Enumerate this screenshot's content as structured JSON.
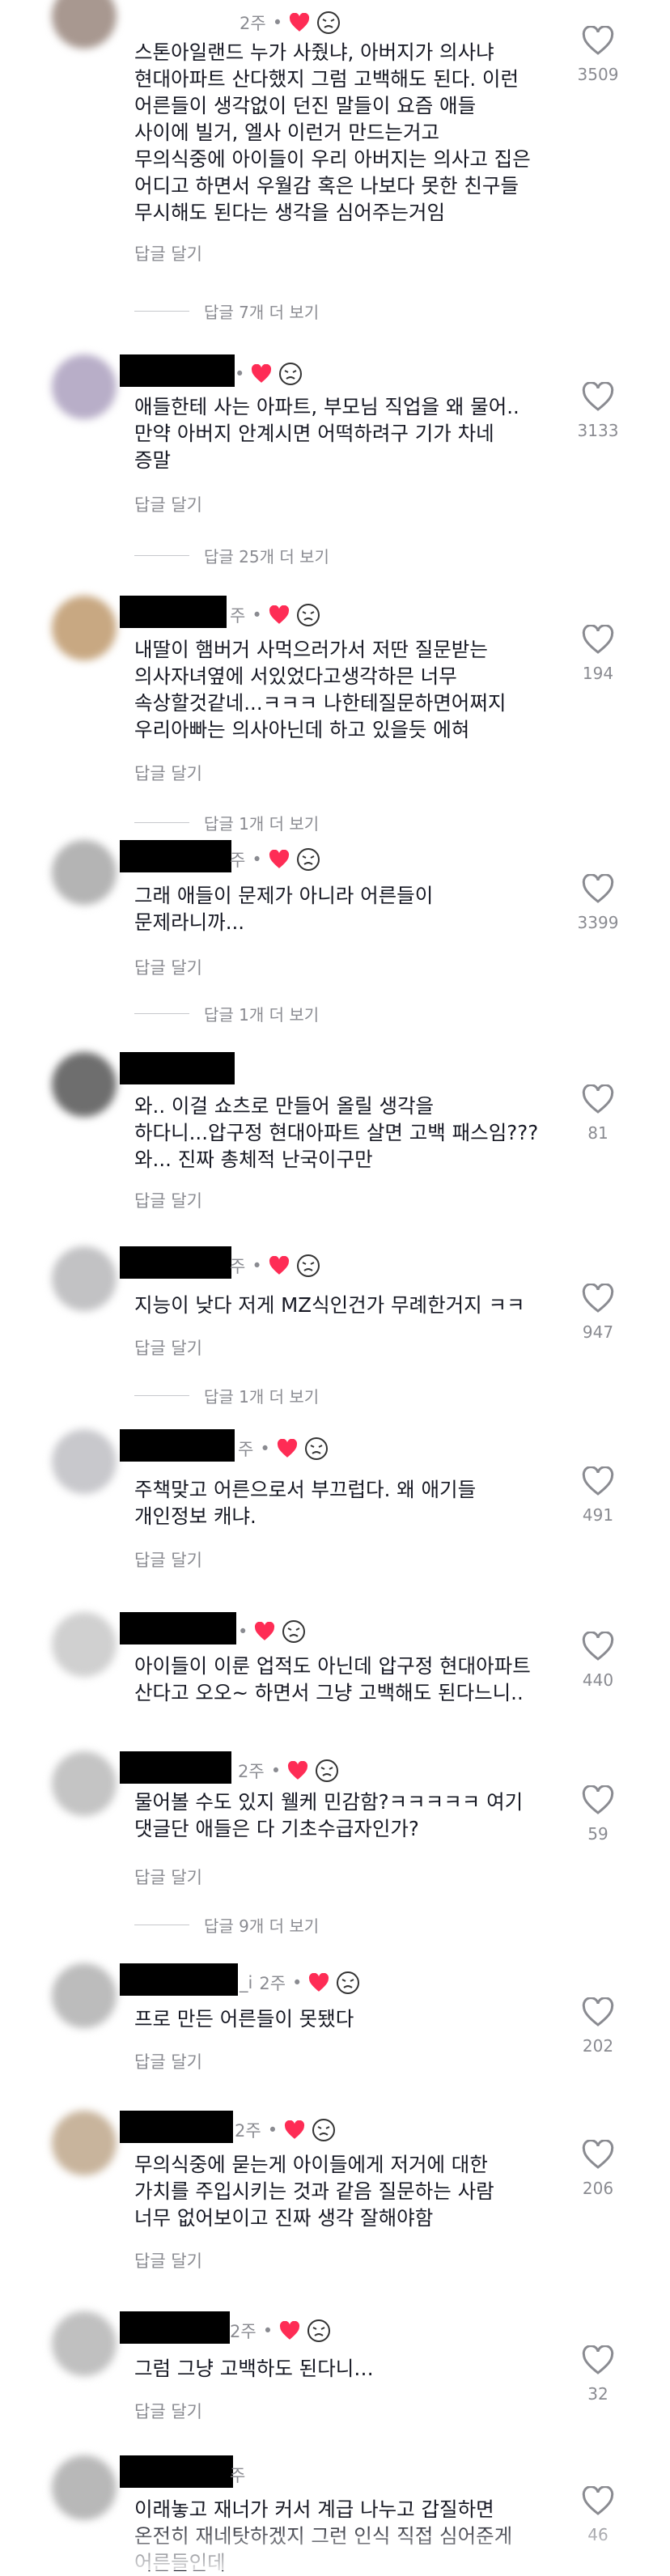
{
  "comments": [
    {
      "time": "2주",
      "text": "스톤아일랜드 누가 사줬냐, 아버지가 의사냐\n현대아파트 산다했지 그럼 고백해도 된다. 이런\n어른들이 생각없이 던진 말들이 요즘 애들\n사이에 빌거, 엘사 이런거 만드는거고\n무의식중에 아이들이 우리 아버지는 의사고 집은\n어디고 하면서 우월감 혹은 나보다 못한 친구들\n무시해도 된다는 생각을 심어주는거임",
      "likes": "3509",
      "reply": "답글 달기",
      "more": "답글 7개 더 보기",
      "avatar": "#a89890"
    },
    {
      "time": "",
      "text": "애들한테 사는 아파트, 부모님 직업을 왜 물어..\n만약 아버지 안계시면 어떡하려구 기가 차네\n증말",
      "likes": "3133",
      "reply": "답글 달기",
      "more": "답글 25개 더 보기",
      "avatar": "#b8aec8"
    },
    {
      "time": "주",
      "text": "내딸이 햄버거 사먹으러가서 저딴 질문받는\n의사자녀옆에 서있었다고생각하믄 너무\n속상할것같네...ㅋㅋㅋ 나한테질문하면어쩌지\n우리아빠는 의사아닌데 하고 있을듯 에혀",
      "likes": "194",
      "reply": "답글 달기",
      "more": "답글 1개 더 보기",
      "avatar": "#c8a882"
    },
    {
      "time": "주",
      "text": "그래 애들이 문제가 아니라 어른들이\n문제라니까...",
      "likes": "3399",
      "reply": "답글 달기",
      "more": "답글 1개 더 보기",
      "avatar": "#b4b4b4"
    },
    {
      "time": "",
      "text": "와.. 이걸 쇼츠로 만들어 올릴 생각을\n하다니...압구정 현대아파트 살면 고백 패스임???\n와... 진짜 총체적 난국이구만",
      "likes": "81",
      "reply": "답글 달기",
      "more": "",
      "avatar": "#6e6e6e"
    },
    {
      "time": "주",
      "text": "지능이 낮다 저게 MZ식인건가 무례한거지 ㅋㅋ",
      "likes": "947",
      "reply": "답글 달기",
      "more": "답글 1개 더 보기",
      "avatar": "#c2c2c4"
    },
    {
      "time": "주",
      "text": "주책맞고 어른으로서 부끄럽다. 왜 애기들\n개인정보 캐냐.",
      "likes": "491",
      "reply": "답글 달기",
      "more": "",
      "avatar": "#c8c8cc"
    },
    {
      "time": "",
      "text": "아이들이 이룬 업적도 아닌데 압구정 현대아파트\n산다고 오오~ 하면서 그냥 고백해도 된다느니..",
      "likes": "440",
      "reply": "",
      "more": "",
      "avatar": "#d0d0d0"
    },
    {
      "time": "2주",
      "text": "물어볼 수도 있지 웰케 민감함?ㅋㅋㅋㅋㅋ 여기\n댓글단 애들은 다 기초수급자인가?",
      "likes": "59",
      "reply": "답글 달기",
      "more": "답글 9개 더 보기",
      "avatar": "#c4c4c4"
    },
    {
      "time": "2주",
      "text": "프로 만든 어른들이 못됐다",
      "likes": "202",
      "reply": "답글 달기",
      "more": "",
      "avatar": "#bcbcbc",
      "name_suffix": "_i"
    },
    {
      "time": "2주",
      "text": "무의식중에 묻는게 아이들에게 저거에 대한\n가치를 주입시키는 것과 같음 질문하는 사람\n너무 없어보이고 진짜 생각 잘해야함",
      "likes": "206",
      "reply": "답글 달기",
      "more": "",
      "avatar": "#c8b49c"
    },
    {
      "time": "2주",
      "text": "그럼 그냥 고백하도 된다니…",
      "likes": "32",
      "reply": "답글 달기",
      "more": "",
      "avatar": "#c0c0c0"
    },
    {
      "time": "주",
      "text": "이래놓고 재너가 커서 계급 나누고 갑질하면\n온전히 재네탓하겠지 그런 인식 직접 심어준게\n어른들인데",
      "likes": "46",
      "reply": "",
      "more": "",
      "avatar": "#b8b8b8"
    }
  ],
  "colors": {
    "heart_red": "#fe2c55",
    "meta_gray": "#8a8b91",
    "text": "#161823"
  },
  "icons": {
    "author_heart": "heart-icon",
    "emoji": "crying-face-icon",
    "like": "heart-outline-icon"
  }
}
